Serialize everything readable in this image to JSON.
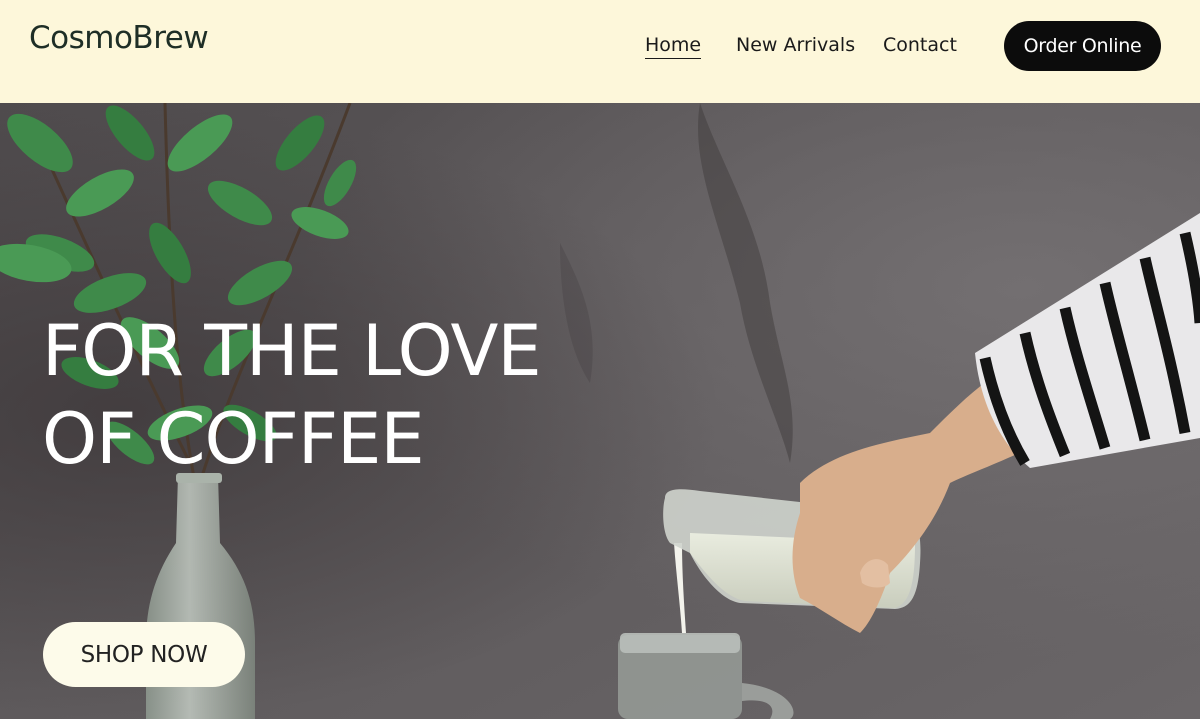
{
  "header": {
    "logo": "CosmoBrew",
    "nav": [
      {
        "label": "Home",
        "active": true
      },
      {
        "label": "New Arrivals",
        "active": false
      },
      {
        "label": "Contact",
        "active": false
      }
    ],
    "order_label": "Order Online"
  },
  "hero": {
    "headline_line1": "FOR THE LOVE",
    "headline_line2": "OF COFFEE",
    "cta_label": "SHOP NOW"
  },
  "colors": {
    "header_bg": "#fdf7da",
    "accent": "#0c0c0c",
    "text_dark": "#1e2e26"
  }
}
